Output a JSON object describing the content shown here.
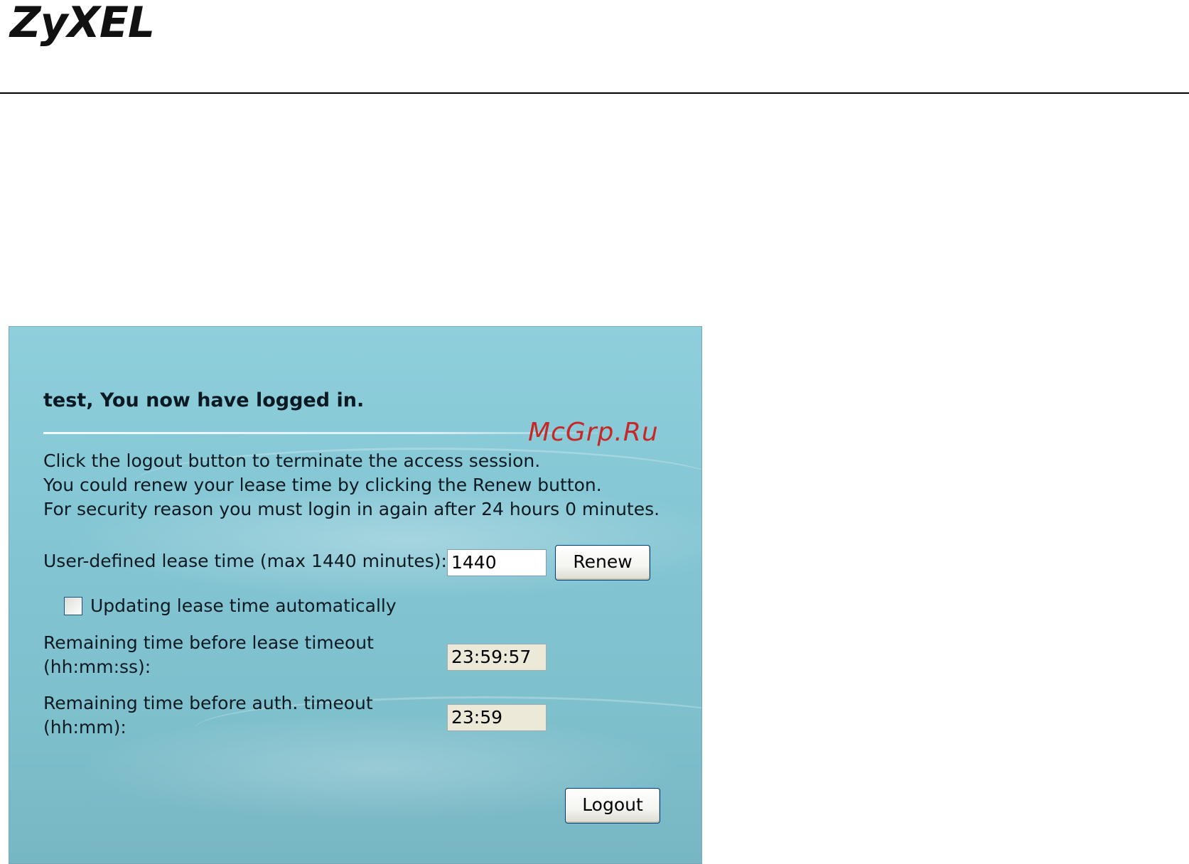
{
  "header": {
    "logo_text": "ZyXEL"
  },
  "watermark": "McGrp.Ru",
  "panel": {
    "heading": "test, You now have logged in.",
    "info_lines": [
      "Click the logout button to terminate the access session.",
      "You could renew your lease time by clicking the Renew button.",
      "For security reason you must login in again after 24 hours 0 minutes."
    ],
    "lease_time": {
      "label": "User-defined lease time (max 1440 minutes):",
      "value": "1440",
      "renew_label": "Renew"
    },
    "auto_update": {
      "label": "Updating lease time automatically",
      "checked": false
    },
    "lease_remaining": {
      "label_line1": "Remaining time before lease timeout",
      "label_line2": "(hh:mm:ss):",
      "value": "23:59:57"
    },
    "auth_remaining": {
      "label_line1": "Remaining time before auth. timeout",
      "label_line2": "(hh:mm):",
      "value": "23:59"
    },
    "logout_label": "Logout"
  }
}
